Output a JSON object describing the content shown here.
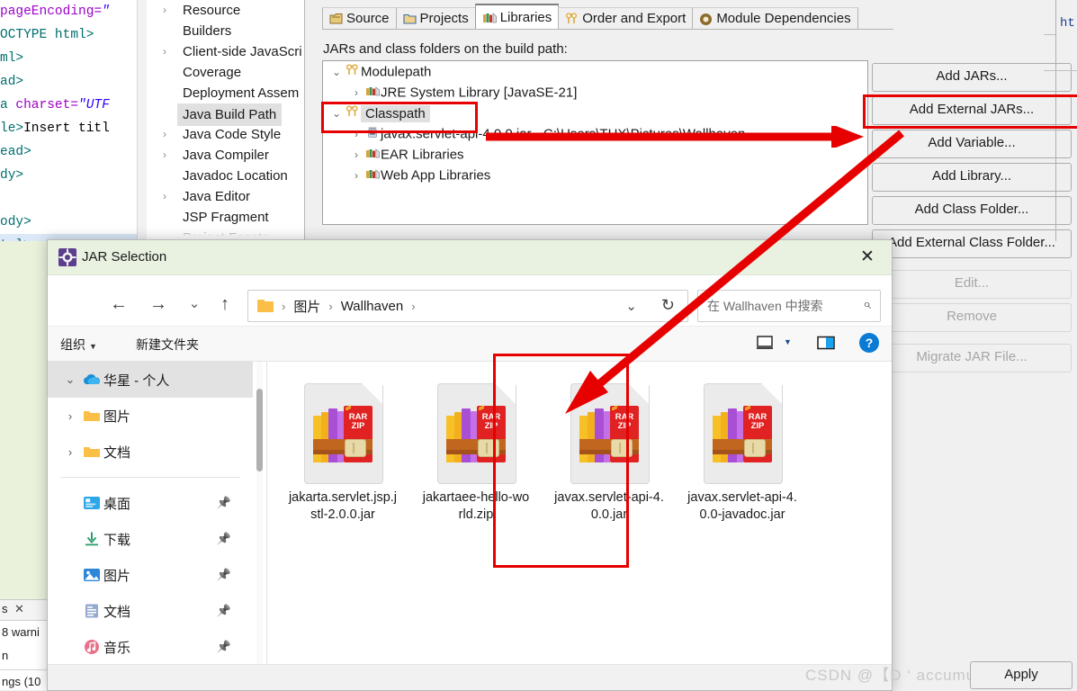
{
  "ide": {
    "editor_lines": [
      {
        "seg": [
          {
            "t": " pageEncoding=",
            "c": "attr"
          },
          {
            "t": "\"",
            "c": "str"
          }
        ]
      },
      {
        "seg": [
          {
            "t": "OCTYPE html>",
            "c": "tag"
          }
        ]
      },
      {
        "seg": [
          {
            "t": "ml>",
            "c": "tag"
          }
        ]
      },
      {
        "seg": [
          {
            "t": "ad>",
            "c": "tag"
          }
        ]
      },
      {
        "seg": [
          {
            "t": "a ",
            "c": "tag"
          },
          {
            "t": "charset=",
            "c": "attr"
          },
          {
            "t": "\"UTF",
            "c": "str"
          }
        ]
      },
      {
        "seg": [
          {
            "t": "le>",
            "c": "tag"
          },
          {
            "t": "Insert titl",
            "c": "txt"
          }
        ]
      },
      {
        "seg": [
          {
            "t": "ead>",
            "c": "tag"
          }
        ]
      },
      {
        "seg": [
          {
            "t": "dy>",
            "c": "tag"
          }
        ]
      },
      {
        "seg": [
          {
            "t": "",
            "c": "txt"
          }
        ]
      },
      {
        "seg": [
          {
            "t": "ody>",
            "c": "tag"
          }
        ]
      },
      {
        "seg": [
          {
            "t": "tml>",
            "c": "tag"
          },
          {
            "t": "",
            "c": "txt"
          }
        ]
      }
    ],
    "right_edge_code": "ht",
    "problems": {
      "close_label": "✕",
      "tab_label": "s",
      "line1": "8 warni",
      "line2": "n",
      "line3": "ngs (10"
    },
    "prefs_tree": [
      {
        "label": "Resource",
        "arrow": "›",
        "selected": false
      },
      {
        "label": "Builders",
        "arrow": "",
        "selected": false
      },
      {
        "label": "Client-side JavaScri",
        "arrow": "›",
        "selected": false
      },
      {
        "label": "Coverage",
        "arrow": "",
        "selected": false
      },
      {
        "label": "Deployment Assem",
        "arrow": "",
        "selected": false
      },
      {
        "label": "Java Build Path",
        "arrow": "",
        "selected": true
      },
      {
        "label": "Java Code Style",
        "arrow": "›",
        "selected": false
      },
      {
        "label": "Java Compiler",
        "arrow": "›",
        "selected": false
      },
      {
        "label": "Javadoc Location",
        "arrow": "",
        "selected": false
      },
      {
        "label": "Java Editor",
        "arrow": "›",
        "selected": false
      },
      {
        "label": "JSP Fragment",
        "arrow": "",
        "selected": false
      },
      {
        "label": "Project Facets",
        "arrow": "",
        "selected": false
      }
    ],
    "tabs": [
      {
        "label": "Source",
        "icon": "source-icon",
        "active": false
      },
      {
        "label": "Projects",
        "icon": "projects-folder-icon",
        "active": false
      },
      {
        "label": "Libraries",
        "icon": "libraries-books-icon",
        "active": true
      },
      {
        "label": "Order and Export",
        "icon": "order-export-icon",
        "active": false
      },
      {
        "label": "Module Dependencies",
        "icon": "module-deps-icon",
        "active": false
      }
    ],
    "jars_label": "JARs and class folders on the build path:",
    "tree": [
      {
        "label": "Modulepath",
        "twisty": "⌄",
        "icon": "modulepath-icon",
        "indent": 0,
        "selected": false
      },
      {
        "label": "JRE System Library [JavaSE-21]",
        "twisty": "›",
        "icon": "library-books-icon",
        "indent": 1,
        "selected": false
      },
      {
        "label": "Classpath",
        "twisty": "⌄",
        "icon": "classpath-icon",
        "indent": 0,
        "selected": true
      },
      {
        "label": "javax.servlet-api-4.0.0.jar - C:\\Users\\THX\\Pictures\\Wallhaven",
        "twisty": "›",
        "icon": "jar-icon",
        "indent": 1,
        "selected": false
      },
      {
        "label": "EAR Libraries",
        "twisty": "›",
        "icon": "library-books-icon",
        "indent": 1,
        "selected": false
      },
      {
        "label": "Web App Libraries",
        "twisty": "›",
        "icon": "library-books-icon",
        "indent": 1,
        "selected": false
      }
    ],
    "buttons": [
      {
        "label": "Add JARs...",
        "disabled": false,
        "gap": false
      },
      {
        "label": "Add External JARs...",
        "disabled": false,
        "gap": false
      },
      {
        "label": "Add Variable...",
        "disabled": false,
        "gap": false
      },
      {
        "label": "Add Library...",
        "disabled": false,
        "gap": false
      },
      {
        "label": "Add Class Folder...",
        "disabled": false,
        "gap": false
      },
      {
        "label": "Add External Class Folder...",
        "disabled": false,
        "gap": false
      },
      {
        "label": "Edit...",
        "disabled": true,
        "gap": true
      },
      {
        "label": "Remove",
        "disabled": true,
        "gap": false
      },
      {
        "label": "Migrate JAR File...",
        "disabled": true,
        "gap": true
      }
    ],
    "apply_label": "Apply"
  },
  "dialog": {
    "title": "JAR Selection",
    "close_label": "✕",
    "nav": {
      "back": "←",
      "forward": "→",
      "recent": "⌄",
      "up": "↑",
      "refresh": "↻",
      "chevron": "⌄"
    },
    "breadcrumbs": [
      "图片",
      "Wallhaven"
    ],
    "breadcrumb_sep": "›",
    "search_placeholder": "在 Wallhaven 中搜索",
    "search_icon": "⌕",
    "toolbar": {
      "organize": "组织",
      "new_folder": "新建文件夹",
      "help": "?"
    },
    "sidebar": [
      {
        "label": "华星 - 个人",
        "icon": "onedrive-cloud-icon",
        "caret": "⌄",
        "pinned": false,
        "header": true
      },
      {
        "label": "图片",
        "icon": "folder-icon",
        "caret": "›",
        "pinned": false,
        "header": false
      },
      {
        "label": "文档",
        "icon": "folder-icon",
        "caret": "›",
        "pinned": false,
        "header": false
      },
      {
        "label": "桌面",
        "icon": "desktop-icon",
        "caret": "",
        "pinned": true,
        "header": false
      },
      {
        "label": "下载",
        "icon": "downloads-icon",
        "caret": "",
        "pinned": true,
        "header": false
      },
      {
        "label": "图片",
        "icon": "pictures-icon",
        "caret": "",
        "pinned": true,
        "header": false
      },
      {
        "label": "文档",
        "icon": "documents-icon",
        "caret": "",
        "pinned": true,
        "header": false
      },
      {
        "label": "音乐",
        "icon": "music-icon",
        "caret": "",
        "pinned": true,
        "header": false
      }
    ],
    "files": [
      {
        "name": "jakarta.servlet.jsp.jstl-2.0.0.jar",
        "icon": "rar-zip-archive-icon",
        "selected": false
      },
      {
        "name": "jakartaee-hello-world.zip",
        "icon": "rar-zip-archive-icon",
        "selected": false
      },
      {
        "name": "javax.servlet-api-4.0.0.jar",
        "icon": "rar-zip-archive-icon",
        "selected": true
      },
      {
        "name": "javax.servlet-api-4.0.0-javadoc.jar",
        "icon": "rar-zip-archive-icon",
        "selected": false
      }
    ],
    "rar_label": "RAR\nZIP"
  },
  "annotations": {
    "highlight_color": "#e60000",
    "watermark": "CSDN @【D ‘ accumulation】"
  }
}
